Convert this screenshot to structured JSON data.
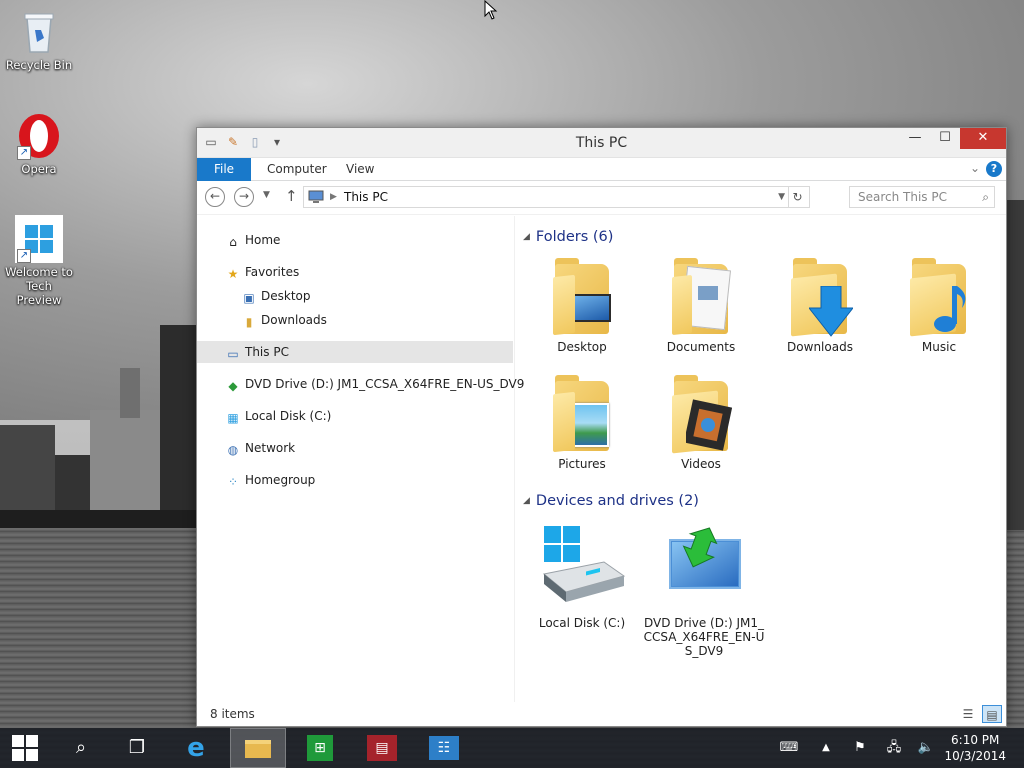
{
  "desktop": {
    "icons": [
      {
        "label": "Recycle Bin"
      },
      {
        "label": "Opera"
      },
      {
        "label": "Welcome to Tech Preview"
      }
    ]
  },
  "window": {
    "title": "This PC",
    "ribbon_tabs": [
      "File",
      "Computer",
      "View"
    ],
    "address_path": "This PC",
    "search_placeholder": "Search This PC",
    "nav": {
      "home": "Home",
      "favorites": "Favorites",
      "desktop": "Desktop",
      "downloads": "Downloads",
      "this_pc": "This PC",
      "dvd": "DVD Drive (D:) JM1_CCSA_X64FRE_EN-US_DV9",
      "local_disk": "Local Disk (C:)",
      "network": "Network",
      "homegroup": "Homegroup"
    },
    "groups": {
      "folders_header": "Folders (6)",
      "devices_header": "Devices and drives (2)"
    },
    "folders": [
      {
        "label": "Desktop"
      },
      {
        "label": "Documents"
      },
      {
        "label": "Downloads"
      },
      {
        "label": "Music"
      },
      {
        "label": "Pictures"
      },
      {
        "label": "Videos"
      }
    ],
    "drives": [
      {
        "label": "Local Disk (C:)"
      },
      {
        "label": "DVD Drive (D:) JM1_CCSA_X64FRE_EN-US_DV9"
      }
    ],
    "status": "8 items"
  },
  "taskbar": {
    "time": "6:10 PM",
    "date": "10/3/2014"
  },
  "colors": {
    "accent": "#1979ca",
    "close": "#c7372f",
    "group_header": "#1e3287"
  }
}
